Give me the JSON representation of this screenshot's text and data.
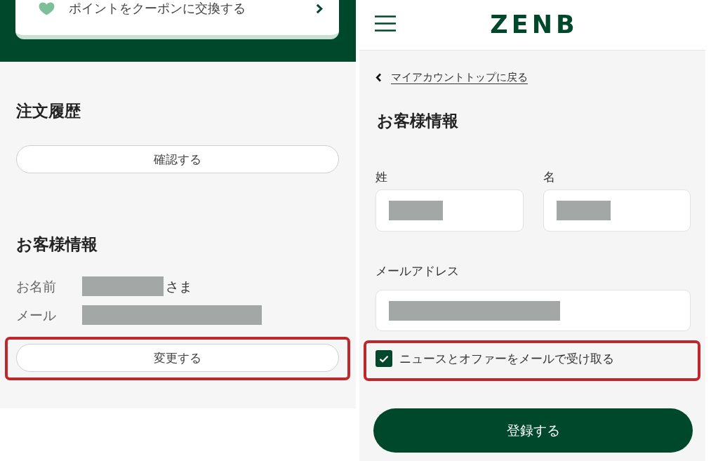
{
  "left_screen": {
    "points_card": {
      "label": "ポイントをクーポンに交換する"
    },
    "order_history": {
      "heading": "注文履歴",
      "button": {
        "label": "確認する"
      }
    },
    "customer_info": {
      "heading": "お客様情報",
      "rows": [
        {
          "label": "お名前",
          "suffix": "さま"
        },
        {
          "label": "メール"
        }
      ],
      "button": {
        "label": "変更する",
        "highlighted": true
      }
    }
  },
  "right_screen": {
    "header": {
      "logo": "ZENB"
    },
    "back_link": "マイアカウントトップに戻る",
    "heading": "お客様情報",
    "name_fields": [
      {
        "label": "姓"
      },
      {
        "label": "名"
      }
    ],
    "email_field": {
      "label": "メールアドレス"
    },
    "newsletter": {
      "label": "ニュースとオファーをメールで受け取る",
      "checked": true,
      "highlighted": true
    },
    "submit_button": {
      "label": "登録する"
    }
  }
}
